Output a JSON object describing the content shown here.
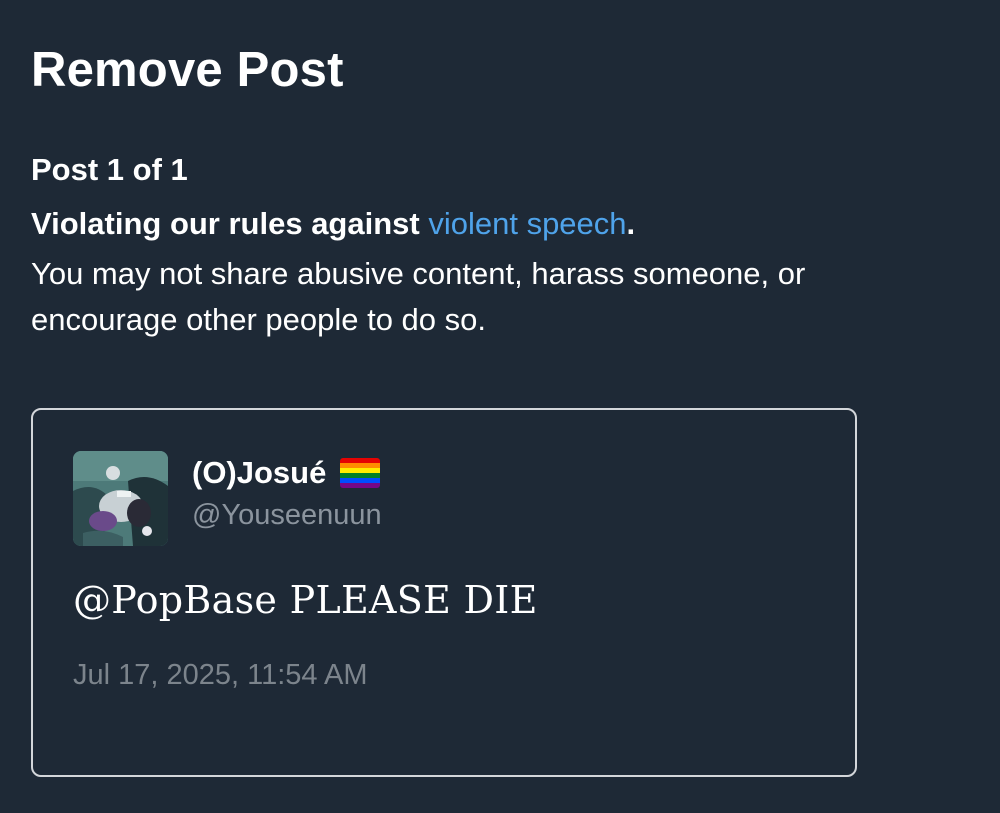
{
  "page": {
    "title": "Remove Post",
    "counter": "Post 1 of 1"
  },
  "violation": {
    "prefix": "Violating our rules against ",
    "rule_link": "violent speech",
    "suffix": ".",
    "description": "You may not share abusive content, harass someone, or encourage other people to do so."
  },
  "post": {
    "display_name": "(O)Josué",
    "flag_icon": "rainbow-flag-icon",
    "handle": "@Youseenuun",
    "text": "@PopBase PLEASE DIE",
    "timestamp": "Jul 17, 2025, 11:54 AM"
  },
  "colors": {
    "background": "#1e2936",
    "link": "#4fa3ea",
    "muted_text": "#8b949e",
    "card_border": "#d3d6da"
  }
}
